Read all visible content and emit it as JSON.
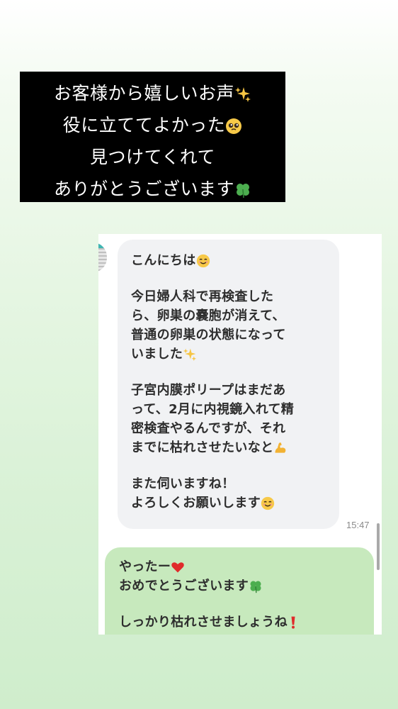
{
  "caption": {
    "lines": [
      {
        "text": "お客様から嬉しいお声",
        "emoji": "sparkles"
      },
      {
        "text": "役に立ててよかった",
        "emoji": "pleading-face"
      },
      {
        "text": "見つけてくれて",
        "emoji": ""
      },
      {
        "text": "ありがとうございます",
        "emoji": "four-leaf-clover"
      }
    ]
  },
  "chat": {
    "incoming": {
      "lines": [
        "こんにちは",
        "",
        "今日婦人科で再検査した",
        "ら、卵巣の嚢胞が消えて、",
        "普通の卵巣の状態になって",
        "いました",
        "",
        "子宮内膜ポリープはまだあ",
        "って、2月に内視鏡入れて精",
        "密検査やるんですが、それ",
        "までに枯れさせたいなと",
        "",
        "また伺いますね！",
        "よろしくお願いします"
      ],
      "time": "15:47"
    },
    "outgoing": {
      "lines": [
        "やったー",
        "おめでとうございます",
        "",
        "しっかり枯れさせましょうね"
      ]
    }
  },
  "colors": {
    "caption_bg": "#000000",
    "incoming_bubble": "#f1f2f4",
    "outgoing_bubble": "#c7e9bd",
    "page_gradient_end": "#cfedcc"
  }
}
